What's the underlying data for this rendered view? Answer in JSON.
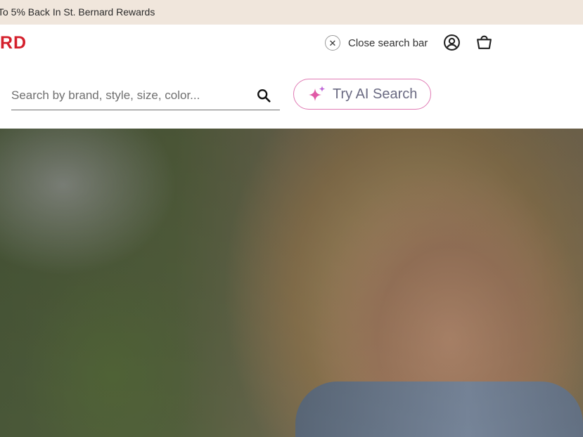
{
  "promo": {
    "text": "To 5% Back In St. Bernard Rewards"
  },
  "header": {
    "logo_text": "RD",
    "close_search_label": "Close search bar",
    "icons": {
      "close": "close-icon",
      "account": "account-icon",
      "bag": "shopping-bag-icon"
    }
  },
  "search": {
    "placeholder": "Search by brand, style, size, color...",
    "value": "",
    "search_icon": "search-icon"
  },
  "ai_search": {
    "label": "Try AI Search",
    "icon": "sparkle-icon"
  },
  "hero": {
    "alt": "hero photo"
  },
  "colors": {
    "promo_bg": "#f0e6dc",
    "brand_red": "#d4202c",
    "ai_accent": "#e07ab4"
  }
}
